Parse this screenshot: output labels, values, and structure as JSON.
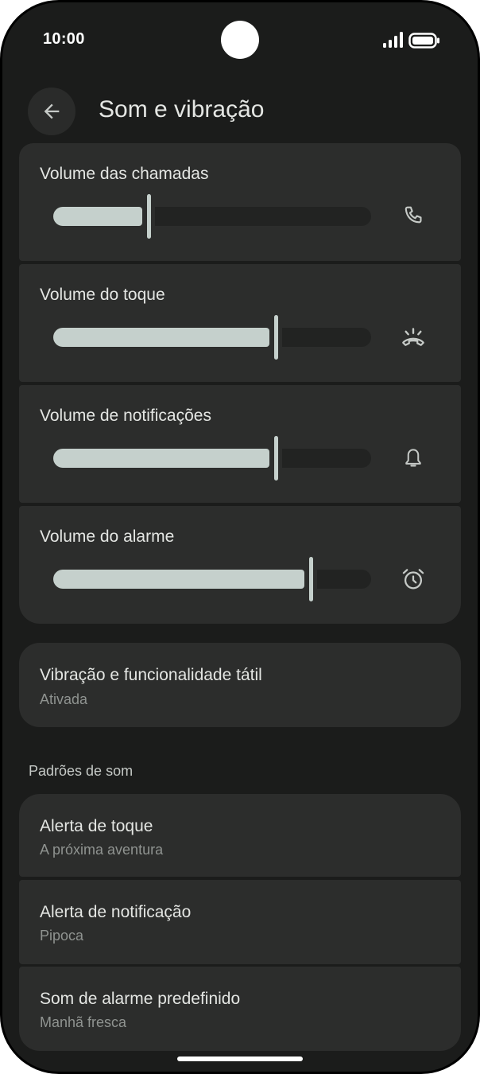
{
  "status_bar": {
    "time": "10:00",
    "icons": [
      "signal-icon",
      "battery-icon"
    ]
  },
  "header": {
    "back_icon": "arrow-left-icon",
    "title": "Som e vibração"
  },
  "volumes": [
    {
      "label": "Volume das chamadas",
      "level": 0.3,
      "icon": "phone-icon"
    },
    {
      "label": "Volume do toque",
      "level": 0.7,
      "icon": "ringer-icon"
    },
    {
      "label": "Volume de notificações",
      "level": 0.7,
      "icon": "bell-icon"
    },
    {
      "label": "Volume do alarme",
      "level": 0.81,
      "icon": "alarm-clock-icon"
    }
  ],
  "vibration": {
    "title": "Vibração e funcionalidade tátil",
    "subtitle": "Ativada"
  },
  "sound_defaults": {
    "header": "Padrões de som",
    "items": [
      {
        "title": "Alerta de toque",
        "subtitle": "A próxima aventura"
      },
      {
        "title": "Alerta de notificação",
        "subtitle": "Pipoca"
      },
      {
        "title": "Som de alarme predefinido",
        "subtitle": "Manhã fresca"
      }
    ]
  },
  "colors": {
    "background": "#1b1c1b",
    "card": "#2c2d2c",
    "slider_active": "#c5d0cc",
    "slider_inactive": "#222322",
    "text_primary": "#e4e6e3",
    "text_secondary": "#8f9390"
  }
}
